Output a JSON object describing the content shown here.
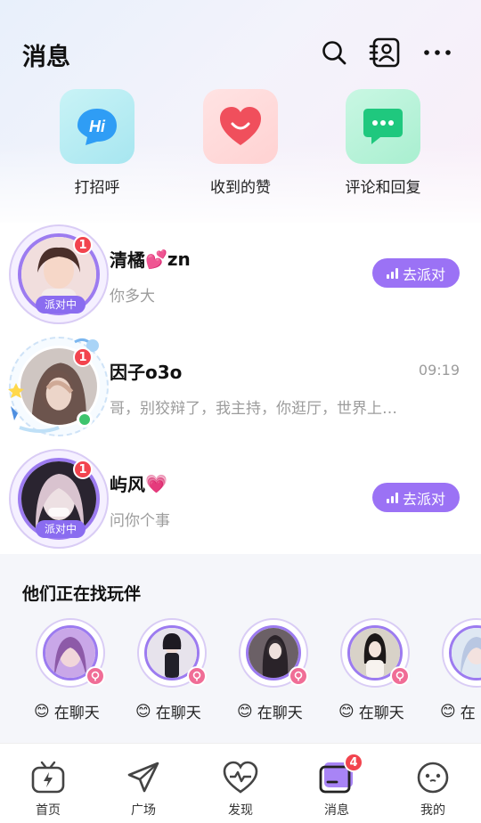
{
  "header": {
    "title": "消息",
    "icons": [
      "search-icon",
      "contacts-icon",
      "more-icon"
    ]
  },
  "quick_actions": [
    {
      "label": "打招呼",
      "icon": "hi-bubble-icon",
      "tile_text": "Hi"
    },
    {
      "label": "收到的赞",
      "icon": "heart-icon"
    },
    {
      "label": "评论和回复",
      "icon": "comment-icon"
    }
  ],
  "conversations": [
    {
      "name": "清橘",
      "name_suffix": "zn",
      "emoji": "💕",
      "preview": "你多大",
      "badge": "1",
      "party_tag": "派对中",
      "action": "去派对",
      "time": ""
    },
    {
      "name": "因子o3o",
      "name_suffix": "",
      "emoji": "",
      "preview": "哥，别狡辩了，我主持，你逛厅，世界上最远的距离",
      "badge": "1",
      "party_tag": "",
      "action": "",
      "time": "09:19"
    },
    {
      "name": "屿风",
      "name_suffix": "",
      "emoji": "💗",
      "preview": "问你个事",
      "badge": "1",
      "party_tag": "派对中",
      "action": "去派对",
      "time": ""
    }
  ],
  "seeking": {
    "title": "他们正在找玩伴",
    "items": [
      {
        "status": "在聊天"
      },
      {
        "status": "在聊天"
      },
      {
        "status": "在聊天"
      },
      {
        "status": "在聊天"
      },
      {
        "status": "在"
      }
    ]
  },
  "tabbar": {
    "items": [
      {
        "label": "首页",
        "icon": "home-tv-icon"
      },
      {
        "label": "广场",
        "icon": "paper-plane-icon"
      },
      {
        "label": "发现",
        "icon": "heartbeat-icon"
      },
      {
        "label": "消息",
        "icon": "message-icon",
        "badge": "4"
      },
      {
        "label": "我的",
        "icon": "face-icon"
      }
    ]
  },
  "colors": {
    "accent": "#9b72f5",
    "badge": "#f2444e",
    "online": "#3ec46d"
  }
}
